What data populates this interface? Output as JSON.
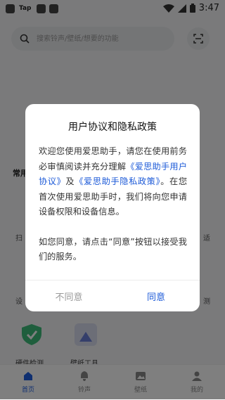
{
  "statusbar": {
    "app_label": "Tap",
    "time": "3:47",
    "icons": [
      "notification-square-icon",
      "notification-square-icon",
      "notification-square-icon",
      "wifi-icon",
      "signal-icon",
      "battery-icon"
    ]
  },
  "search": {
    "placeholder": "搜索铃声/壁纸/想要的功能"
  },
  "background": {
    "section_title": "常用",
    "frag_scan": "扫",
    "frag_set": "设",
    "frag_right_1": "适",
    "frag_right_2": "测",
    "tool_1_label": "硬件检测",
    "tool_2_label": "壁纸工具"
  },
  "bottomnav": {
    "items": [
      {
        "label": "首页",
        "icon": "home-icon",
        "active": true
      },
      {
        "label": "铃声",
        "icon": "bell-icon",
        "active": false
      },
      {
        "label": "壁纸",
        "icon": "image-icon",
        "active": false
      },
      {
        "label": "我的",
        "icon": "user-icon",
        "active": false
      }
    ]
  },
  "dialog": {
    "title": "用户协议和隐私政策",
    "body_intro": "欢迎您使用爱思助手，请您在使用前务必审慎阅读并充分理解",
    "link_user_agreement": "《爱思助手用户协议》",
    "body_and": "及",
    "link_privacy": "《爱思助手隐私政策》",
    "body_rest": "。在您首次使用爱思助手时，我们将向您申请设备权限和设备信息。",
    "body_consent": "如您同意，请点击“同意”按钮以接受我们的服务。",
    "disagree_label": "不同意",
    "agree_label": "同意"
  },
  "colors": {
    "accent": "#1e5bd8",
    "overlay": "rgba(0,0,0,0.5)",
    "muted": "#999999"
  }
}
